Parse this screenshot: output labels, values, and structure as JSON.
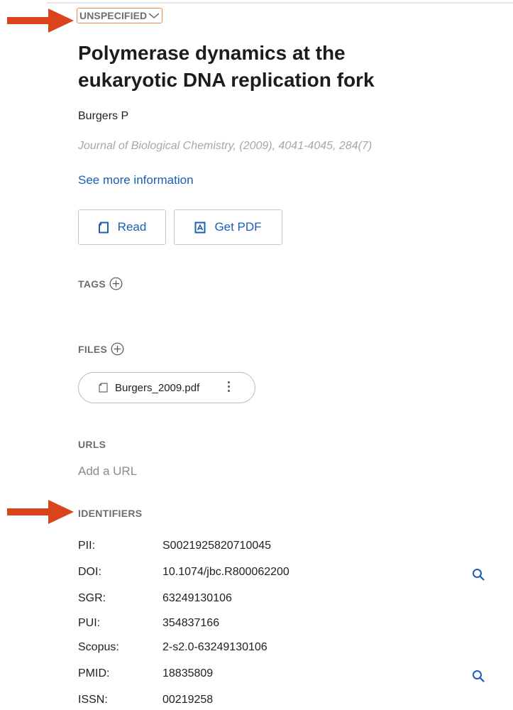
{
  "reference_type": "UNSPECIFIED",
  "title": "Polymerase dynamics at the eukaryotic DNA replication fork",
  "authors": "Burgers P",
  "journal": "Journal of Biological Chemistry, (2009), 4041-4045, 284(7)",
  "see_more": "See more information",
  "buttons": {
    "read": "Read",
    "get_pdf": "Get PDF"
  },
  "sections": {
    "tags": "TAGS",
    "files": "FILES",
    "urls": "URLS",
    "identifiers": "IDENTIFIERS"
  },
  "files": [
    {
      "name": "Burgers_2009.pdf"
    }
  ],
  "add_url": "Add a URL",
  "identifiers": [
    {
      "key": "PII:",
      "value": "S0021925820710045",
      "search": false
    },
    {
      "key": "DOI:",
      "value": "10.1074/jbc.R800062200",
      "search": true
    },
    {
      "key": "SGR:",
      "value": "63249130106",
      "search": false
    },
    {
      "key": "PUI:",
      "value": "354837166",
      "search": false
    },
    {
      "key": "Scopus:",
      "value": "2-s2.0-63249130106",
      "search": false
    },
    {
      "key": "PMID:",
      "value": "18835809",
      "search": true
    },
    {
      "key": "ISSN:",
      "value": "00219258",
      "search": false
    }
  ],
  "colors": {
    "link": "#1a5fb4",
    "highlight": "#f0884b",
    "arrow": "#d9441c"
  }
}
